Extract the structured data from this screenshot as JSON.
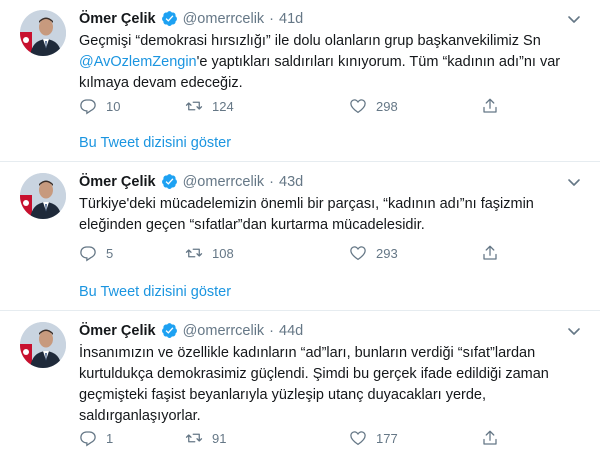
{
  "author": {
    "name": "Ömer Çelik",
    "handle": "@omerrcelik",
    "separator": "·"
  },
  "colors": {
    "link": "#1b95e0",
    "muted": "#657786",
    "text": "#14171a",
    "divider": "#e6ecf0"
  },
  "thread_link_label": "Bu Tweet dizisini göster",
  "tweets": [
    {
      "time": "41d",
      "text_parts": {
        "before": "Geçmişi “demokrasi hırsızlığı” ile dolu olanların grup başkanvekilimiz Sn ",
        "mention": "@AvOzlemZengin",
        "after": "'e yaptıkları saldırıları kınıyorum. Tüm “kadının adı”nı var kılmaya devam edeceğiz."
      },
      "replies": "10",
      "retweets": "124",
      "likes": "298",
      "thread_link": "Bu Tweet dizisini göster"
    },
    {
      "time": "43d",
      "text": "Türkiye'deki mücadelemizin önemli bir parçası, “kadının adı”nı faşizmin eleğinden geçen “sıfatlar”dan kurtarma mücadelesidir.",
      "replies": "5",
      "retweets": "108",
      "likes": "293",
      "thread_link": "Bu Tweet dizisini göster"
    },
    {
      "time": "44d",
      "text": "İnsanımızın ve özellikle kadınların “ad”ları, bunların verdiği “sıfat”lardan kurtuldukça demokrasimiz güçlendi. Şimdi bu gerçek ifade edildiği zaman geçmişteki faşist beyanlarıyla yüzleşip utanç duyacakları yerde, saldırganlaşıyorlar.",
      "replies": "1",
      "retweets": "91",
      "likes": "177"
    }
  ],
  "icons": {
    "verified": "verified-badge-icon",
    "caret": "chevron-down-icon",
    "reply": "reply-icon",
    "retweet": "retweet-icon",
    "like": "heart-icon",
    "share": "share-icon"
  }
}
